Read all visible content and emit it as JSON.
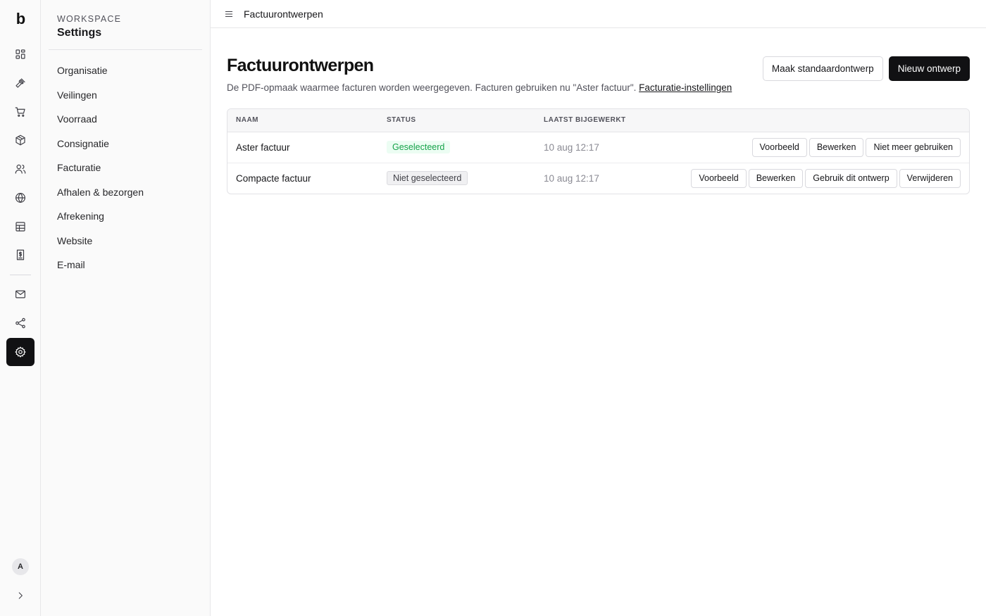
{
  "rail": {
    "logo": "b",
    "avatar_initial": "A",
    "items": [
      {
        "icon": "dashboard-icon"
      },
      {
        "icon": "gavel-icon"
      },
      {
        "icon": "cart-icon"
      },
      {
        "icon": "package-icon"
      },
      {
        "icon": "users-icon"
      },
      {
        "icon": "globe-icon"
      },
      {
        "icon": "table-icon"
      },
      {
        "icon": "invoice-icon"
      },
      {
        "icon": "mail-icon"
      },
      {
        "icon": "share-icon"
      },
      {
        "icon": "settings-icon",
        "active": true
      }
    ]
  },
  "sidebar": {
    "kicker": "WORKSPACE",
    "title": "Settings",
    "items": [
      {
        "label": "Organisatie"
      },
      {
        "label": "Veilingen"
      },
      {
        "label": "Voorraad"
      },
      {
        "label": "Consignatie"
      },
      {
        "label": "Facturatie"
      },
      {
        "label": "Afhalen & bezorgen"
      },
      {
        "label": "Afrekening"
      },
      {
        "label": "Website"
      },
      {
        "label": "E-mail"
      }
    ]
  },
  "topbar": {
    "breadcrumb": "Factuurontwerpen"
  },
  "page": {
    "title": "Factuurontwerpen",
    "subtitle": "De PDF-opmaak waarmee facturen worden weergegeven. Facturen gebruiken nu \"Aster factuur\".",
    "settings_link": "Facturatie-instellingen",
    "make_default_label": "Maak standaardontwerp",
    "new_design_label": "Nieuw ontwerp"
  },
  "table": {
    "columns": [
      "NAAM",
      "STATUS",
      "LAATST BIJGEWERKT"
    ],
    "rows": [
      {
        "name": "Aster factuur",
        "status": "Geselecteerd",
        "status_color": "#16a34a",
        "updated": "10 aug 12:17",
        "actions": [
          "Voorbeeld",
          "Bewerken",
          "Niet meer gebruiken"
        ]
      },
      {
        "name": "Compacte factuur",
        "status": "Niet geselecteerd",
        "status_color": "#3f3f46",
        "updated": "10 aug 12:17",
        "actions": [
          "Voorbeeld",
          "Bewerken",
          "Gebruik dit ontwerp",
          "Verwijderen"
        ]
      }
    ]
  }
}
